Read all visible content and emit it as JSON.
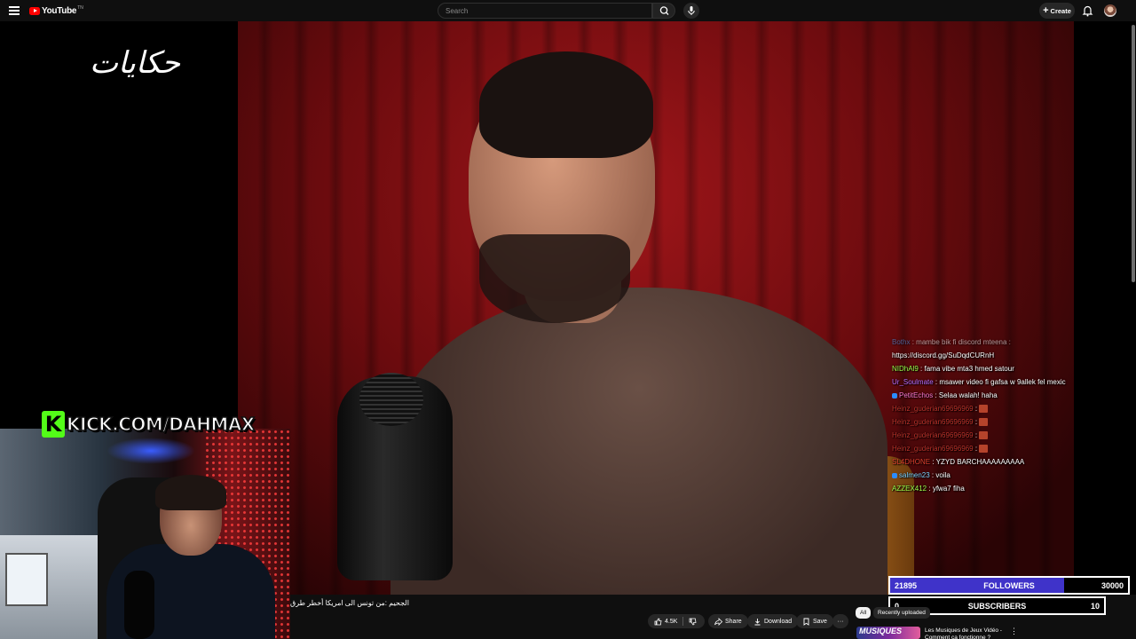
{
  "topbar": {
    "logo_text": "YouTube",
    "logo_superscript": "TN",
    "search_placeholder": "Search",
    "create_label": "Create"
  },
  "video": {
    "channel_logo_text": "حكايات",
    "title": "الجحيم :من تونس الى امريكا أخطر طرق"
  },
  "stream_overlay": {
    "kick_k": "K",
    "kick_url": "KICK.COM/DAHMAX",
    "chat": [
      {
        "user": "Bothx",
        "text": ": mambe bik fi discord mteena :",
        "user_color": "#4fa3ff",
        "faded": true
      },
      {
        "user": "",
        "text": "https://discord.gg/SuDqdCURnH",
        "user_color": "#ffffff"
      },
      {
        "user": "NIDhAl9",
        "text": ": fama vibe mta3 hmed satour",
        "user_color": "#9eff4a"
      },
      {
        "user": "Ur_Soulmate",
        "text": ": msawer video fi gafsa w 9allek fel mexic",
        "user_color": "#b66dff"
      },
      {
        "user": "PetitEchos",
        "text": ": Selaa walah! haha",
        "user_color": "#ff7ad1",
        "badge": true
      },
      {
        "user": "Heinz_guderian69696969",
        "text": ":",
        "user_color": "#c0342c",
        "emote": true
      },
      {
        "user": "Heinz_guderian69696969",
        "text": ":",
        "user_color": "#c0342c",
        "emote": true
      },
      {
        "user": "Heinz_guderian69696969",
        "text": ":",
        "user_color": "#c0342c",
        "emote": true
      },
      {
        "user": "Heinz_guderian69696969",
        "text": ":",
        "user_color": "#c0342c",
        "emote": true
      },
      {
        "user": "SL4DHONE",
        "text": ": YZYD BARCHAAAAAAAAA",
        "user_color": "#e2402e"
      },
      {
        "user": "salmen23",
        "text": ": voila",
        "user_color": "#7dd3ff",
        "badge": true
      },
      {
        "user": "AZZEX412",
        "text": ": yfwa7 fiha",
        "user_color": "#9eff4a"
      }
    ],
    "followers": {
      "count": "21895",
      "label": "FOLLOWERS",
      "target": "30000",
      "progress": 0.73
    },
    "subscribers": {
      "count": "0",
      "label": "SUBSCRIBERS",
      "target": "10",
      "progress": 0
    }
  },
  "actions": {
    "likes": "4.5K",
    "share": "Share",
    "download": "Download",
    "save": "Save",
    "more": "···"
  },
  "recommendations": {
    "chips": [
      "All",
      "Recently uploaded"
    ],
    "item_title": "Les Musiques de Jeux Vidéo - Comment ça fonctionne ?",
    "item_thumb_text": "MUSIQUES",
    "more": "⋮"
  },
  "colors": {
    "kick_green": "#53fc18",
    "goal_fill": "#3f33c9",
    "youtube_red": "#ff0000"
  }
}
